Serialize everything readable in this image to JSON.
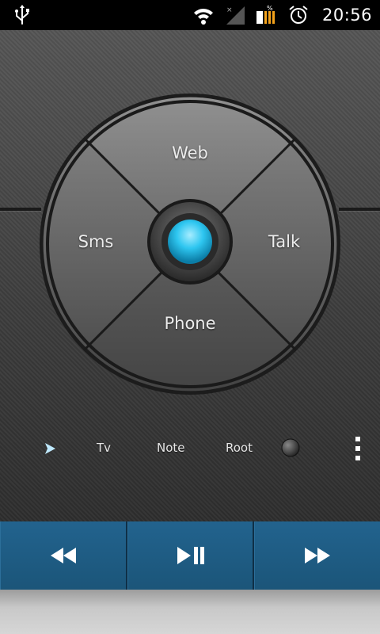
{
  "status_bar": {
    "time": "20:56",
    "icons": [
      "usb-icon",
      "wifi-icon",
      "signal-icon",
      "battery-icon",
      "alarm-icon"
    ]
  },
  "wheel": {
    "top": "Web",
    "left": "Sms",
    "right": "Talk",
    "bottom": "Phone",
    "center_color": "#2ec6f0"
  },
  "options": {
    "tv": "Tv",
    "note": "Note",
    "root": "Root"
  },
  "media": {
    "buttons": [
      "rewind-icon",
      "play-pause-icon",
      "fast-forward-icon"
    ],
    "color": "#1e5a82"
  }
}
